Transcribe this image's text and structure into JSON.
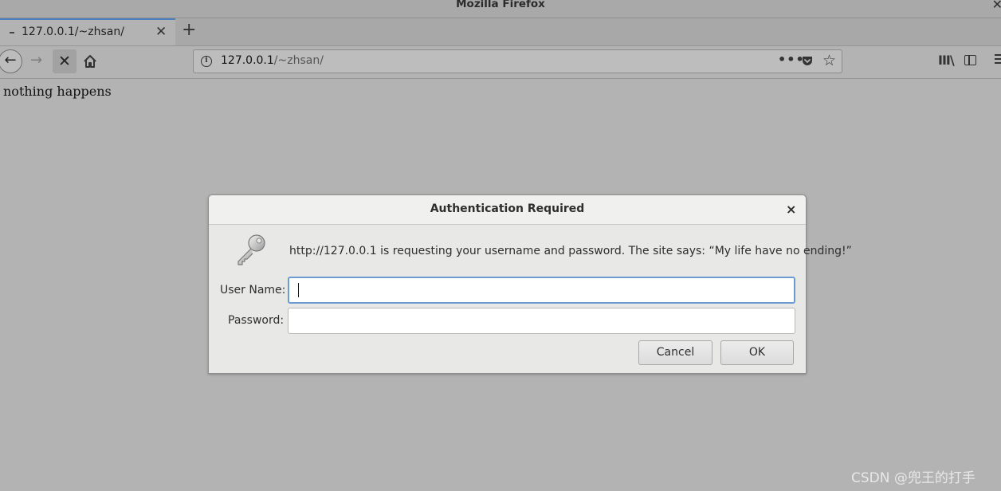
{
  "window": {
    "title": "Mozilla Firefox",
    "close_glyph": "✕"
  },
  "tabs": [
    {
      "label": "127.0.0.1/~zhsan/",
      "close_glyph": "✕",
      "active": true
    }
  ],
  "new_tab_glyph": "+",
  "navbar": {
    "back_glyph": "←",
    "forward_glyph": "→",
    "stop_glyph": "✕",
    "url_host": "127.0.0.1",
    "url_path": "/~zhsan/",
    "more_glyph": "•••",
    "star_glyph": "☆",
    "library_glyph": "III\\"
  },
  "page": {
    "text": "nothing happens"
  },
  "dialog": {
    "title": "Authentication Required",
    "close_glyph": "×",
    "message": "http://127.0.0.1 is requesting your username and password. The site says: “My life have no ending!”",
    "username_label": "User Name:",
    "password_label": "Password:",
    "username_value": "",
    "password_value": "",
    "cancel_label": "Cancel",
    "ok_label": "OK"
  },
  "watermark": "CSDN @兜王的打手",
  "icons": {
    "info": "info-icon",
    "pocket": "pocket-icon",
    "home": "home-icon",
    "key": "key-icon",
    "sidebar": "sidebar-icon",
    "menu": "hamburger-menu-icon"
  }
}
